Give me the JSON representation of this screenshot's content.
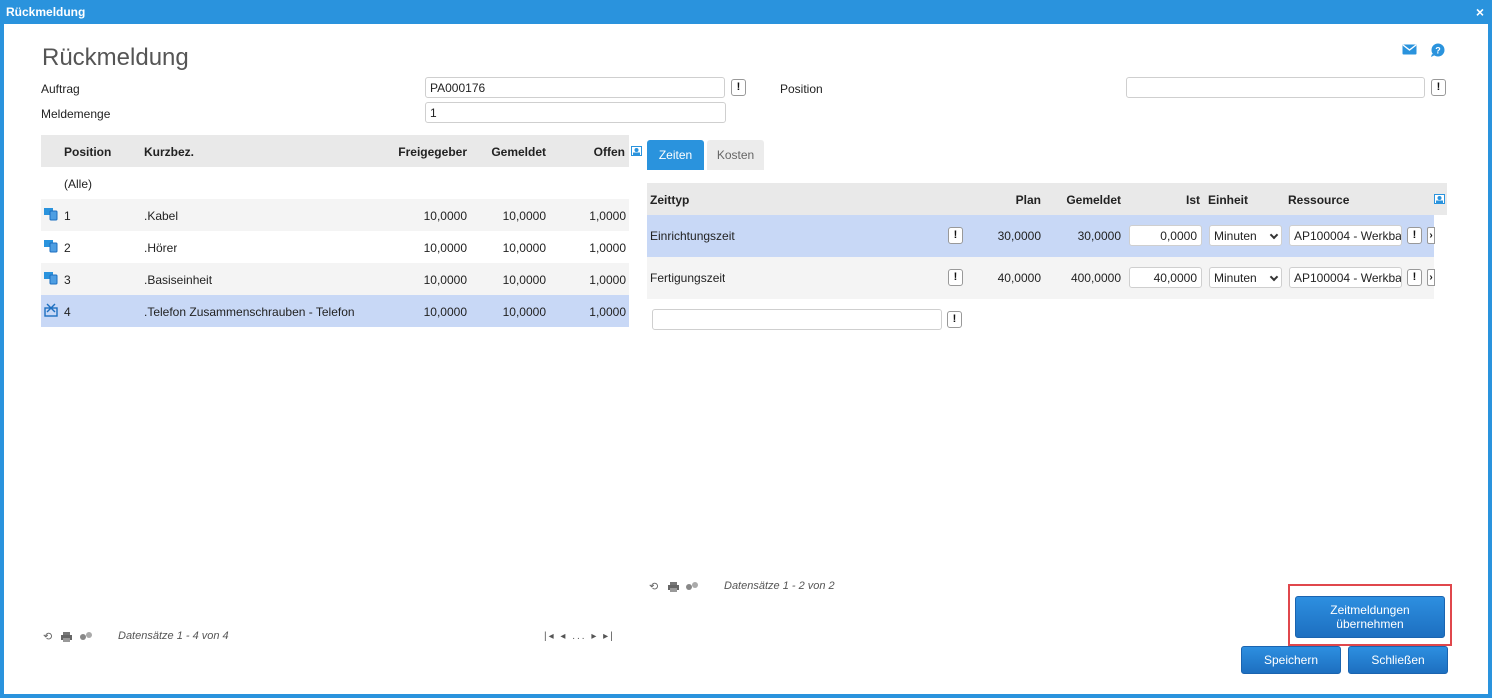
{
  "window": {
    "title": "Rückmeldung",
    "close": "×"
  },
  "page": {
    "heading": "Rückmeldung"
  },
  "header_icons": {
    "mail": "mail-icon",
    "help": "help-chat-icon"
  },
  "form": {
    "auftrag_label": "Auftrag",
    "auftrag_value": "PA000176",
    "meldemenge_label": "Meldemenge",
    "meldemenge_value": "1",
    "position_label": "Position",
    "position_value": ""
  },
  "positions_grid": {
    "headers": {
      "position": "Position",
      "kurzbez": "Kurzbez.",
      "freigegeber": "Freigegeber",
      "gemeldet": "Gemeldet",
      "offen": "Offen"
    },
    "all_label": "(Alle)",
    "rows": [
      {
        "position": "1",
        "kurzbez": ".Kabel",
        "freigegeber": "10,0000",
        "gemeldet": "10,0000",
        "offen": "1,0000",
        "icon": "phone-part-icon"
      },
      {
        "position": "2",
        "kurzbez": ".Hörer",
        "freigegeber": "10,0000",
        "gemeldet": "10,0000",
        "offen": "1,0000",
        "icon": "phone-part-icon"
      },
      {
        "position": "3",
        "kurzbez": ".Basiseinheit",
        "freigegeber": "10,0000",
        "gemeldet": "10,0000",
        "offen": "1,0000",
        "icon": "phone-part-icon"
      },
      {
        "position": "4",
        "kurzbez": ".Telefon Zusammenschrauben - Telefon",
        "freigegeber": "10,0000",
        "gemeldet": "10,0000",
        "offen": "1,0000",
        "icon": "assembly-icon"
      }
    ],
    "footer": {
      "records": "Datensätze 1 - 4 von 4",
      "pager_ellipsis": "..."
    }
  },
  "tabs": [
    {
      "label": "Zeiten"
    },
    {
      "label": "Kosten"
    }
  ],
  "times_grid": {
    "headers": {
      "zeittyp": "Zeittyp",
      "plan": "Plan",
      "gemeldet": "Gemeldet",
      "ist": "Ist",
      "einheit": "Einheit",
      "ressource": "Ressource"
    },
    "rows": [
      {
        "zeittyp": "Einrichtungszeit",
        "plan": "30,0000",
        "gemeldet": "30,0000",
        "ist": "0,0000",
        "einheit": "Minuten",
        "ressource": "AP100004 - Werkba"
      },
      {
        "zeittyp": "Fertigungszeit",
        "plan": "40,0000",
        "gemeldet": "400,0000",
        "ist": "40,0000",
        "einheit": "Minuten",
        "ressource": "AP100004 - Werkba"
      }
    ],
    "new_input_value": "",
    "footer": {
      "records": "Datensätze 1 - 2 von 2"
    }
  },
  "buttons": {
    "zeitmeldungen_line1": "Zeitmeldungen",
    "zeitmeldungen_line2": "übernehmen",
    "save": "Speichern",
    "close": "Schließen"
  },
  "colors": {
    "accent": "#2a93dd",
    "selected_row": "#c8d8f6",
    "highlight_border": "#e0474c"
  }
}
